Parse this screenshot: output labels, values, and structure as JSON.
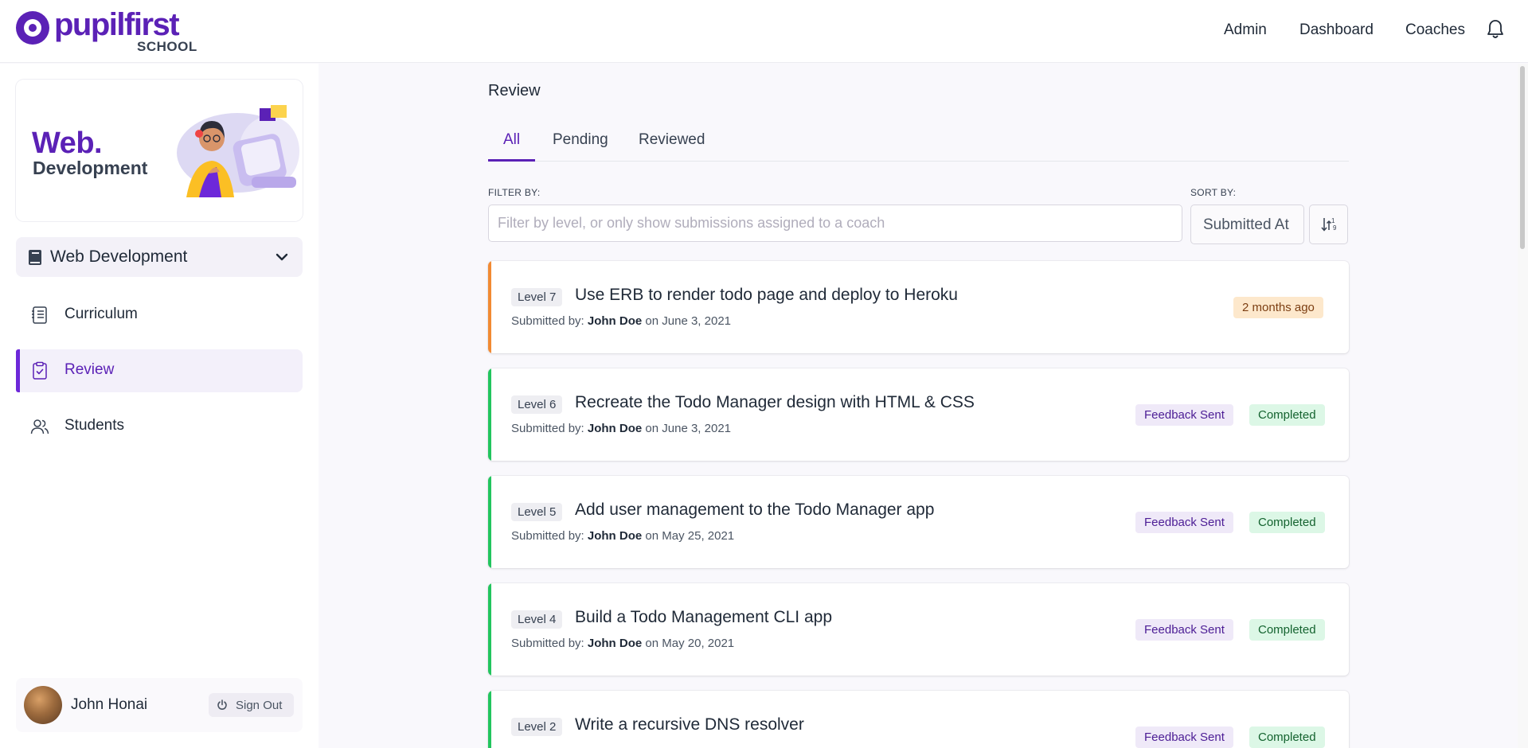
{
  "brand": {
    "name": "pupilfirst",
    "sub": "SCHOOL"
  },
  "topnav": [
    "Admin",
    "Dashboard",
    "Coaches"
  ],
  "sidebar": {
    "banner": {
      "title": "Web.",
      "subtitle": "Development"
    },
    "course": "Web Development",
    "items": [
      {
        "label": "Curriculum",
        "icon": "curriculum-icon"
      },
      {
        "label": "Review",
        "icon": "review-clipboard-icon",
        "active": true
      },
      {
        "label": "Students",
        "icon": "students-icon"
      }
    ],
    "user": {
      "name": "John Honai",
      "signout": "Sign Out"
    }
  },
  "main": {
    "title": "Review",
    "tabs": [
      "All",
      "Pending",
      "Reviewed"
    ],
    "active_tab": "All",
    "filter_label": "FILTER BY:",
    "filter_placeholder": "Filter by level, or only show submissions assigned to a coach",
    "sort_label": "SORT BY:",
    "sort_value": "Submitted At",
    "submissions": [
      {
        "level": "Level 7",
        "title": "Use ERB to render todo page and deploy to Heroku",
        "by_prefix": "Submitted by:",
        "by": "John Doe",
        "on": "on June 3, 2021",
        "status": "pending",
        "age": "2 months ago"
      },
      {
        "level": "Level 6",
        "title": "Recreate the Todo Manager design with HTML & CSS",
        "by_prefix": "Submitted by:",
        "by": "John Doe",
        "on": "on June 3, 2021",
        "status": "completed",
        "feedback": "Feedback Sent",
        "result": "Completed"
      },
      {
        "level": "Level 5",
        "title": "Add user management to the Todo Manager app",
        "by_prefix": "Submitted by:",
        "by": "John Doe",
        "on": "on May 25, 2021",
        "status": "completed",
        "feedback": "Feedback Sent",
        "result": "Completed"
      },
      {
        "level": "Level 4",
        "title": "Build a Todo Management CLI app",
        "by_prefix": "Submitted by:",
        "by": "John Doe",
        "on": "on May 20, 2021",
        "status": "completed",
        "feedback": "Feedback Sent",
        "result": "Completed"
      },
      {
        "level": "Level 2",
        "title": "Write a recursive DNS resolver",
        "by_prefix": "",
        "by": "",
        "on": "",
        "status": "completed",
        "feedback": "Feedback Sent",
        "result": "Completed"
      }
    ]
  },
  "colors": {
    "brand": "#5b21b6",
    "pending": "#f28a33",
    "completed": "#22c55e"
  }
}
